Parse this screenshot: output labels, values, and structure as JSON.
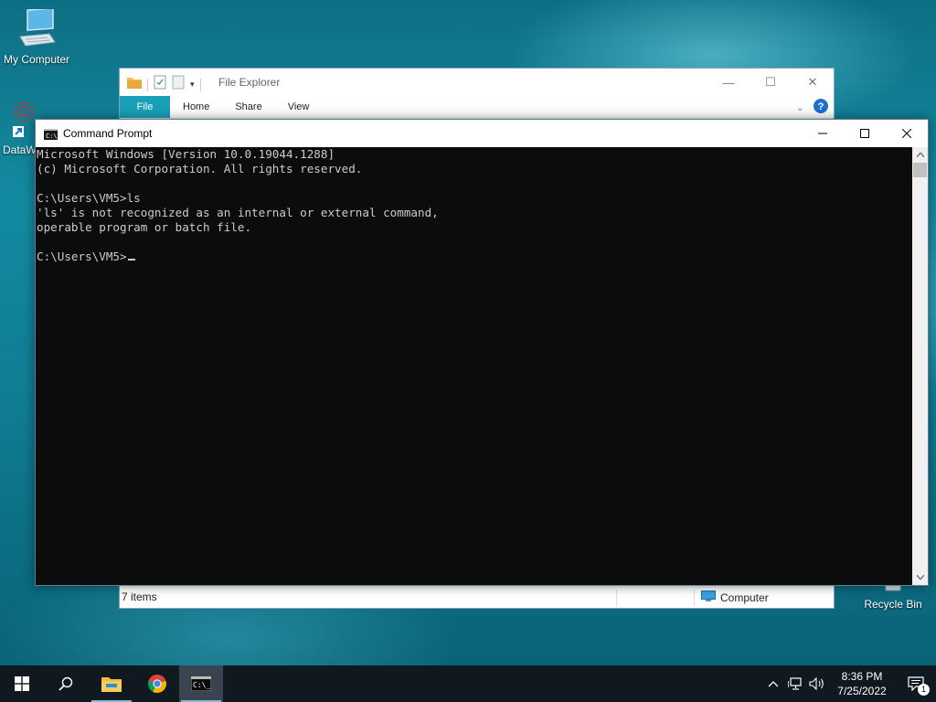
{
  "desktop": {
    "icons": [
      {
        "label": "My Computer"
      },
      {
        "label": "DataW"
      },
      {
        "label": "Recycle Bin"
      }
    ]
  },
  "explorer": {
    "title": "File Explorer",
    "tabs": [
      "File",
      "Home",
      "Share",
      "View"
    ],
    "status_count": "7 items",
    "status_location": "Computer",
    "controls": {
      "minimize": "—",
      "maximize": "☐",
      "close": "✕"
    }
  },
  "cmd": {
    "title": "Command Prompt",
    "lines": [
      "Microsoft Windows [Version 10.0.19044.1288]",
      "(c) Microsoft Corporation. All rights reserved.",
      "",
      "C:\\Users\\VM5>ls",
      "'ls' is not recognized as an internal or external command,",
      "operable program or batch file.",
      ""
    ],
    "prompt": "C:\\Users\\VM5>"
  },
  "taskbar": {
    "time": "8:36 PM",
    "date": "7/25/2022",
    "notification_count": "1",
    "apps": [
      {
        "icon": "windows-start-icon"
      },
      {
        "icon": "search-icon"
      },
      {
        "icon": "file-explorer-icon"
      },
      {
        "icon": "chrome-icon"
      },
      {
        "icon": "command-prompt-icon"
      }
    ]
  },
  "colors": {
    "accent": "#19a0b8",
    "console_bg": "#0c0c0c",
    "console_fg": "#cccccc",
    "taskbar_bg": "#101820"
  }
}
